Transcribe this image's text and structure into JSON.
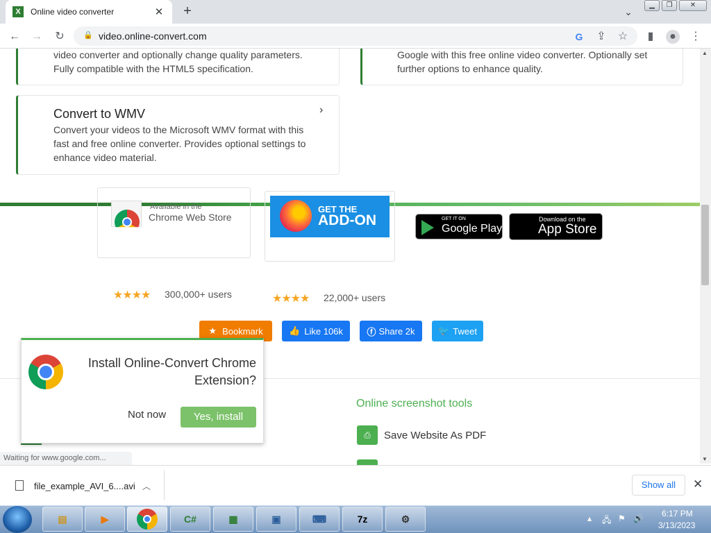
{
  "browser": {
    "tab_title": "Online video converter",
    "tab_favicon": "X",
    "url": "video.online-convert.com"
  },
  "cards": {
    "top_left_desc_1": "video converter and optionally change quality parameters.",
    "top_left_desc_2": "Fully compatible with the HTML5 specification.",
    "top_right_desc_1": "Google with this free online video converter. Optionally set",
    "top_right_desc_2": "further options to enhance quality.",
    "wmv_title": "Convert to WMV",
    "wmv_desc_1": "Convert your videos to the Microsoft WMV format with this",
    "wmv_desc_2": "fast and free online converter. Provides optional settings to",
    "wmv_desc_3": "enhance video material."
  },
  "badges": {
    "cws_line1": "Available in the",
    "cws_line2": "Chrome Web Store",
    "cws_stars": "★★★★",
    "cws_users": "300,000+ users",
    "ff_line1": "GET THE",
    "ff_line2": "ADD-ON",
    "ff_stars": "★★★★",
    "ff_users": "22,000+ users",
    "gplay_line1": "GET IT ON",
    "gplay_line2": "Google Play",
    "appstore_line1": "Download on the",
    "appstore_line2": "App Store"
  },
  "share": {
    "bookmark": "Bookmark",
    "like": "Like 106k",
    "share": "Share 2k",
    "tweet": "Tweet"
  },
  "popup": {
    "text": "Install Online-Convert Chrome Extension?",
    "not_now": "Not now",
    "yes": "Yes, install"
  },
  "footer": {
    "section_title": "Online screenshot tools",
    "pdf_link": "Save Website As PDF"
  },
  "status_text": "Waiting for www.google.com...",
  "download": {
    "file_name": "file_example_AVI_6....avi",
    "show_all": "Show all"
  },
  "taskbar": {
    "time": "6:17 PM",
    "date": "3/13/2023"
  },
  "colors": {
    "brand_green": "#2e7d32",
    "bookmark": "#f07c00",
    "facebook": "#1877f2",
    "twitter": "#1da1f2"
  }
}
